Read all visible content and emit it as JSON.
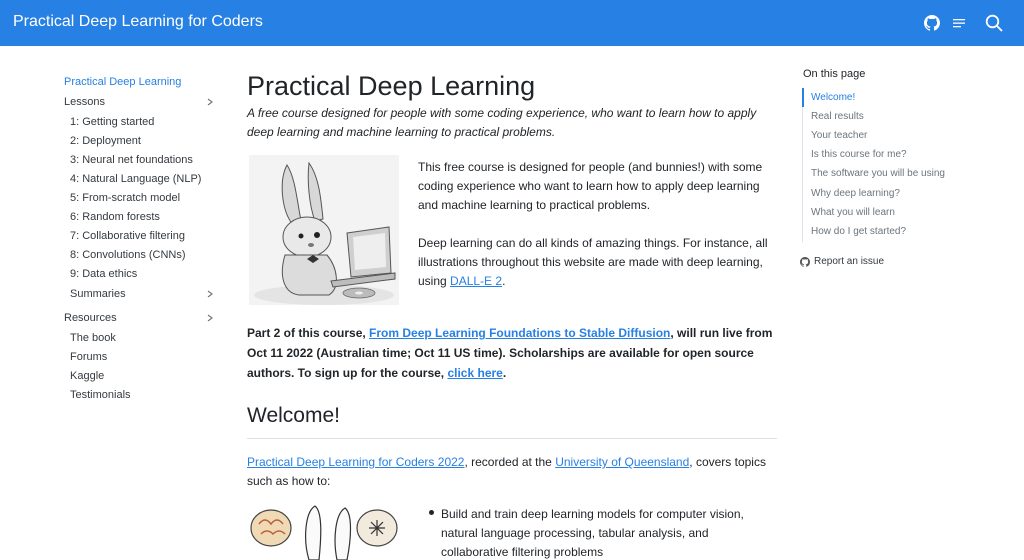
{
  "navbar": {
    "brand": "Practical Deep Learning for Coders",
    "icons": [
      "github-icon",
      "menu-lines-icon",
      "search-icon"
    ],
    "color": "#2780e3"
  },
  "sidebar": {
    "items": [
      {
        "label": "Practical Deep Learning",
        "active": true
      },
      {
        "label": "Lessons",
        "expandable": true
      },
      {
        "label": "1: Getting started"
      },
      {
        "label": "2: Deployment"
      },
      {
        "label": "3: Neural net foundations"
      },
      {
        "label": "4: Natural Language (NLP)"
      },
      {
        "label": "5: From-scratch model"
      },
      {
        "label": "6: Random forests"
      },
      {
        "label": "7: Collaborative filtering"
      },
      {
        "label": "8: Convolutions (CNNs)"
      },
      {
        "label": "9: Data ethics"
      },
      {
        "label": "Summaries",
        "expandable": true
      },
      {
        "label": "Resources",
        "expandable": true
      },
      {
        "label": "The book"
      },
      {
        "label": "Forums"
      },
      {
        "label": "Kaggle"
      },
      {
        "label": "Testimonials"
      }
    ]
  },
  "main": {
    "title": "Practical Deep Learning",
    "subtitle": "A free course designed for people with some coding experience, who want to learn how to apply deep learning and machine learning to practical problems.",
    "intro_p1": "This free course is designed for people (and bunnies!) with some coding experience who want to learn how to apply deep learning and machine learning to practical problems.",
    "intro_p2_prefix": "Deep learning can do all kinds of amazing things. For instance, all illustrations throughout this website are made with deep learning, using ",
    "intro_p2_link": "DALL-E 2",
    "intro_p2_suffix": ".",
    "part2_prefix": "Part 2 of this course, ",
    "part2_link": "From Deep Learning Foundations to Stable Diffusion",
    "part2_middle": ", will run live from Oct 11 2022 (Australian time; Oct 11 US time). Scholarships are available for open source authors. To sign up for the course, ",
    "part2_link2": "click here",
    "part2_suffix": ".",
    "welcome_heading": "Welcome!",
    "welcome_p_link1": "Practical Deep Learning for Coders 2022",
    "welcome_p_mid": ", recorded at the ",
    "welcome_p_link2": "University of Queensland",
    "welcome_p_suffix": ", covers topics such as how to:",
    "bullet1": "Build and train deep learning models for computer vision, natural language processing, tabular analysis, and collaborative filtering problems"
  },
  "toc": {
    "title": "On this page",
    "items": [
      {
        "label": "Welcome!",
        "active": true
      },
      {
        "label": "Real results"
      },
      {
        "label": "Your teacher"
      },
      {
        "label": "Is this course for me?"
      },
      {
        "label": "The software you will be using"
      },
      {
        "label": "Why deep learning?"
      },
      {
        "label": "What you will learn"
      },
      {
        "label": "How do I get started?"
      }
    ],
    "report_issue": "Report an issue"
  }
}
